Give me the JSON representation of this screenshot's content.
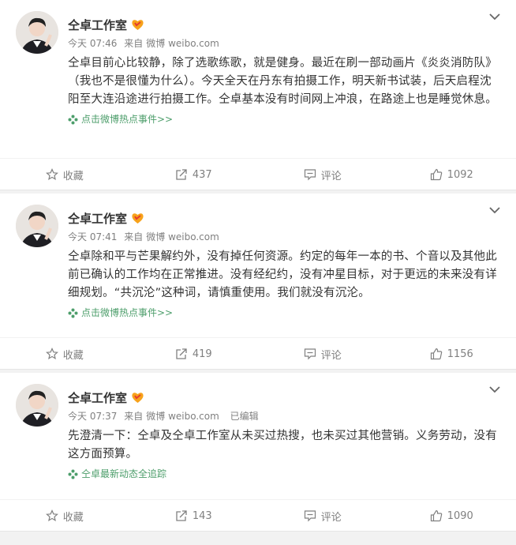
{
  "posts": [
    {
      "name": "仝卓工作室",
      "time": "今天 07:46",
      "source_prefix": "来自",
      "source": "微博 weibo.com",
      "edited": "",
      "text": "仝卓目前心比较静，除了选歌练歌，就是健身。最近在刷一部动画片《炎炎消防队》（我也不是很懂为什么）。今天全天在丹东有拍摄工作，明天新书试装，后天启程沈阳至大连沿途进行拍摄工作。仝卓基本没有时间网上冲浪，在路途上也是睡觉休息。",
      "topic": "点击微博热点事件>>",
      "actions": {
        "favorite": "收藏",
        "repost": "437",
        "comment": "评论",
        "like": "1092"
      }
    },
    {
      "name": "仝卓工作室",
      "time": "今天 07:41",
      "source_prefix": "来自",
      "source": "微博 weibo.com",
      "edited": "",
      "text": "仝卓除和平与芒果解约外，没有掉任何资源。约定的每年一本的书、个音以及其他此前已确认的工作均在正常推进。没有经纪约，没有冲星目标，对于更远的未来没有详细规划。“共沉沦”这种词，请慎重使用。我们就没有沉沦。",
      "topic": "点击微博热点事件>>",
      "actions": {
        "favorite": "收藏",
        "repost": "419",
        "comment": "评论",
        "like": "1156"
      }
    },
    {
      "name": "仝卓工作室",
      "time": "今天 07:37",
      "source_prefix": "来自",
      "source": "微博 weibo.com",
      "edited": "已编辑",
      "text": "先澄清一下：仝卓及仝卓工作室从未买过热搜，也未买过其他营销。义务劳动，没有这方面预算。",
      "topic": "仝卓最新动态全追踪",
      "actions": {
        "favorite": "收藏",
        "repost": "143",
        "comment": "评论",
        "like": "1090"
      }
    }
  ],
  "colors": {
    "accent_topic": "#4d9e6b",
    "meta": "#808080",
    "text": "#333333"
  },
  "icons": [
    "star-icon",
    "repost-icon",
    "comment-icon",
    "like-icon",
    "chevron-down-icon",
    "vip-badge-icon",
    "topic-icon"
  ]
}
